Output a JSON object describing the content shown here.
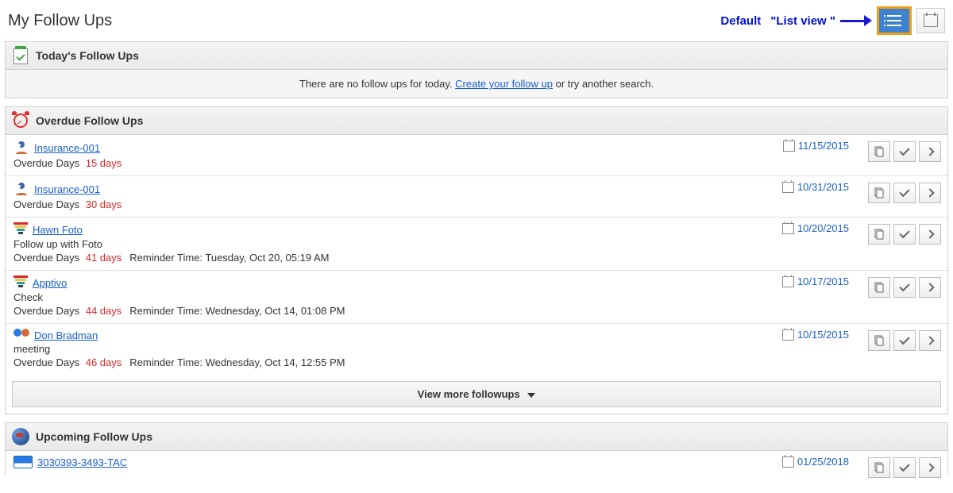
{
  "pageTitle": "My Follow Ups",
  "header": {
    "defaultLabel": "Default",
    "listViewLabel": "\"List view \""
  },
  "today": {
    "title": "Today's Follow Ups",
    "emptyPrefix": "There are no follow ups for today. ",
    "emptyLink": "Create your follow up",
    "emptySuffix": " or try another search."
  },
  "overdue": {
    "title": "Overdue Follow Ups",
    "overdueLabel": "Overdue Days",
    "reminderLabel": "Reminder Time:",
    "items": [
      {
        "iconType": "opp",
        "name": "Insurance-001",
        "desc": "",
        "date": "11/15/2015",
        "days": "15 days",
        "reminder": ""
      },
      {
        "iconType": "opp",
        "name": "Insurance-001",
        "desc": "",
        "date": "10/31/2015",
        "days": "30 days",
        "reminder": ""
      },
      {
        "iconType": "funnel",
        "name": "Hawn Foto",
        "desc": "Follow up with Foto",
        "date": "10/20/2015",
        "days": "41 days",
        "reminder": "Tuesday, Oct 20, 05:19 AM"
      },
      {
        "iconType": "funnel",
        "name": "Apptivo",
        "desc": "Check",
        "date": "10/17/2015",
        "days": "44 days",
        "reminder": "Wednesday, Oct 14, 01:08 PM"
      },
      {
        "iconType": "contact",
        "name": "Don Bradman",
        "desc": "meeting",
        "date": "10/15/2015",
        "days": "46 days",
        "reminder": "Wednesday, Oct 14, 12:55 PM"
      }
    ],
    "viewMore": "View more followups"
  },
  "upcoming": {
    "title": "Upcoming Follow Ups",
    "items": [
      {
        "iconType": "card",
        "name": "3030393-3493-TAC",
        "date": "01/25/2018"
      }
    ]
  }
}
